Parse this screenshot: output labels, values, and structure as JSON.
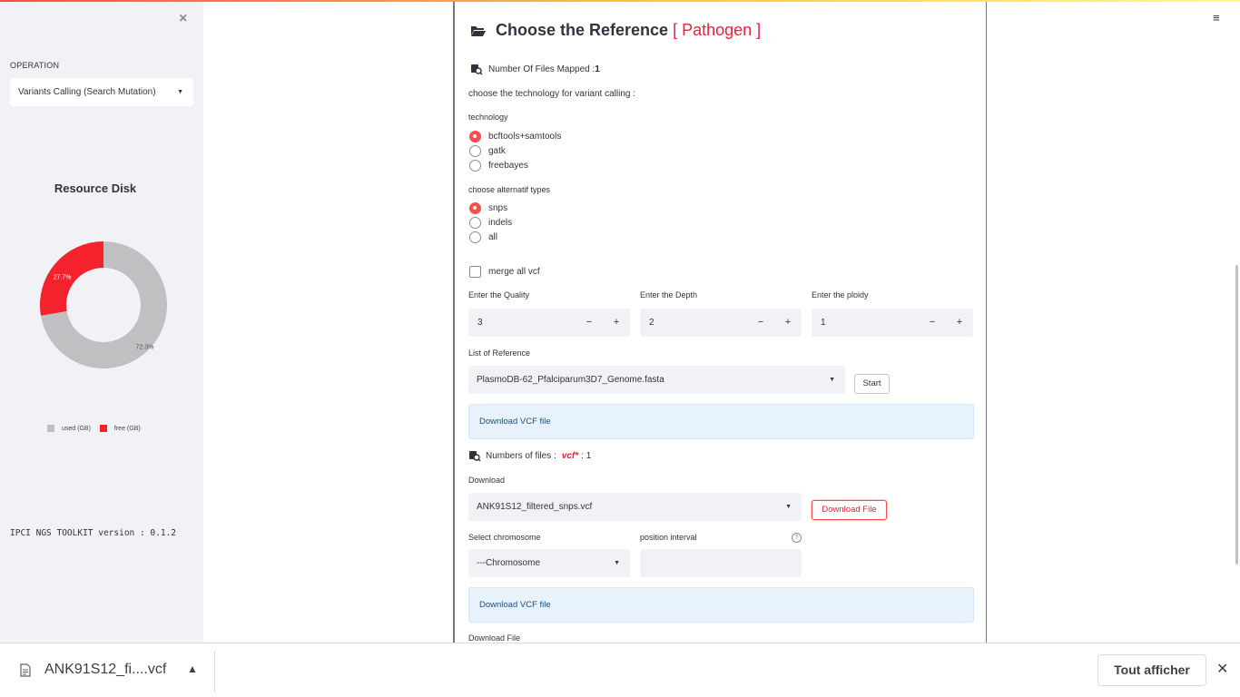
{
  "sidebar": {
    "close_symbol": "×",
    "operation_label": "OPERATION",
    "operation_value": "Variants Calling (Search Mutation)",
    "resource_disk_title": "Resource Disk",
    "chart_data": {
      "type": "pie",
      "categories": [
        "used (GB)",
        "free (GB)"
      ],
      "values": [
        72.3,
        27.7
      ],
      "labels": [
        "72.3%",
        "27.7%"
      ],
      "colors": [
        "#c0c0c2",
        "#f4222d"
      ],
      "legend": "bottom"
    },
    "version_text": "IPCI NGS TOOLKIT version : 0.1.2"
  },
  "main": {
    "title": "Choose the Reference",
    "title_accent": "[ Pathogen ]",
    "files_mapped_label": "Number Of Files Mapped :",
    "files_mapped_count": "1",
    "technology_prompt": "choose the technology for variant calling :",
    "technology_label": "technology",
    "technology_options": [
      "bcftools+samtools",
      "gatk",
      "freebayes"
    ],
    "technology_selected": "bcftools+samtools",
    "alt_types_label": "choose alternatif types",
    "alt_type_options": [
      "snps",
      "indels",
      "all"
    ],
    "alt_type_selected": "snps",
    "merge_label": "merge all vcf",
    "quality_label": "Enter the Quality",
    "quality_value": "3",
    "depth_label": "Enter the Depth",
    "depth_value": "2",
    "ploidy_label": "Enter the ploidy",
    "ploidy_value": "1",
    "minus": "−",
    "plus": "+",
    "reference_label": "List of Reference",
    "reference_value": "PlasmoDB-62_Pfalciparum3D7_Genome.fasta",
    "start_label": "Start",
    "download_vcf_label": "Download VCF file",
    "num_files_label": "Numbers of files :",
    "num_files_type": "vcf*",
    "num_files_count": ": 1",
    "download_label": "Download",
    "download_select_value": "ANK91S12_filtered_snps.vcf",
    "download_file_button": "Download File",
    "chromosome_label": "Select chromosome",
    "chromosome_value": "---Chromosome",
    "position_label": "position interval",
    "help_symbol": "?",
    "download_vcf_label_2": "Download VCF file",
    "download_file_label": "Download File"
  },
  "header": {
    "menu_symbol": "≡"
  },
  "download_bar": {
    "file_name": "ANK91S12_fi....vcf",
    "show_all": "Tout afficher",
    "close_symbol": "✕"
  }
}
